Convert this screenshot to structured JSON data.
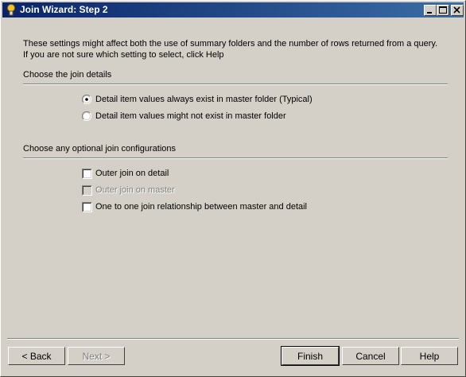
{
  "window": {
    "title": "Join Wizard: Step 2",
    "controls": {
      "minimize": "minimize",
      "maximize": "maximize",
      "close": "close"
    }
  },
  "intro": {
    "line1": "These settings might affect both the use of summary folders and the number of rows returned from a query.",
    "line2": "If you are not sure which setting to select, click Help"
  },
  "join_details": {
    "heading": "Choose the join details",
    "options": [
      {
        "label": "Detail item values always exist in master folder (Typical)",
        "selected": true
      },
      {
        "label": "Detail item values might not exist in master folder",
        "selected": false
      }
    ]
  },
  "optional": {
    "heading": "Choose any optional join configurations",
    "options": [
      {
        "label": "Outer join on detail",
        "checked": false,
        "enabled": true
      },
      {
        "label": "Outer join on master",
        "checked": false,
        "enabled": false
      },
      {
        "label": "One to one join relationship between master and detail",
        "checked": false,
        "enabled": true
      }
    ]
  },
  "buttons": {
    "back": "< Back",
    "next": "Next >",
    "finish": "Finish",
    "cancel": "Cancel",
    "help": "Help"
  }
}
